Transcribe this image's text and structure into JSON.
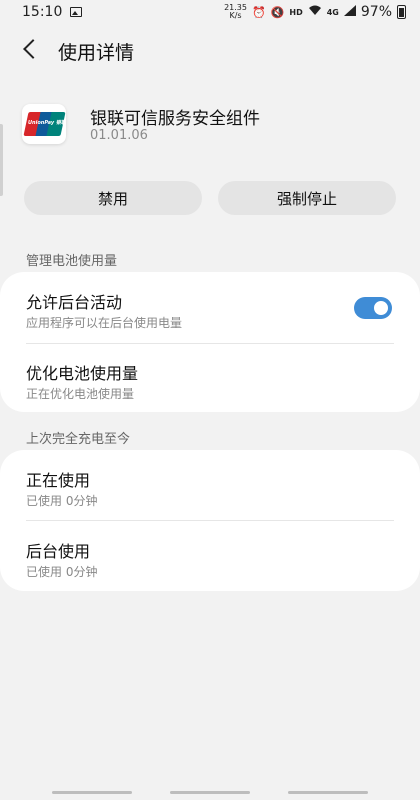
{
  "status_bar": {
    "time": "15:10",
    "net_speed_value": "21.35",
    "net_speed_unit": "K/s",
    "hd_label": "HD",
    "network_label": "4G",
    "battery_percent": "97%"
  },
  "header": {
    "title": "使用详情"
  },
  "app": {
    "name": "银联可信服务安全组件",
    "version": "01.01.06",
    "logo_text": "UnionPay 银联"
  },
  "actions": {
    "disable_label": "禁用",
    "force_stop_label": "强制停止"
  },
  "battery_section": {
    "header": "管理电池使用量",
    "rows": [
      {
        "title": "允许后台活动",
        "subtitle": "应用程序可以在后台使用电量",
        "toggle_on": true
      },
      {
        "title": "优化电池使用量",
        "subtitle": "正在优化电池使用量"
      }
    ]
  },
  "usage_section": {
    "header": "上次完全充电至今",
    "rows": [
      {
        "title": "正在使用",
        "subtitle": "已使用 0分钟"
      },
      {
        "title": "后台使用",
        "subtitle": "已使用 0分钟"
      }
    ]
  },
  "colors": {
    "accent": "#3f8cd6",
    "background": "#f2f2f2",
    "card": "#ffffff"
  }
}
